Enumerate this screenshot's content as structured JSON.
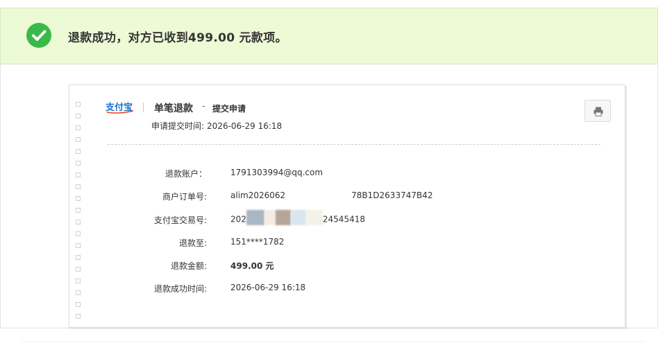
{
  "banner": {
    "message_prefix": "退款成功，对方已收到",
    "amount": "499.00",
    "message_suffix": " 元款项。"
  },
  "receipt": {
    "brand": "支付宝",
    "title": "单笔退款",
    "dash": "-",
    "subtitle": "提交申请",
    "submit_time_label": "申请提交时间:",
    "submit_time_value": "2026-06-29 16:18",
    "rows": [
      {
        "label": "退款账户：",
        "value": "1791303994@qq.com"
      },
      {
        "label": "商户订单号:",
        "value_start": "alim2026062",
        "value_end": "78B1D2633747B42"
      },
      {
        "label": "支付宝交易号:",
        "value_start": "202",
        "value_end": "24545418"
      },
      {
        "label": "退款至:",
        "value": "151****1782"
      },
      {
        "label": "退款金额:",
        "value": "499.00 元"
      },
      {
        "label": "退款成功时间:",
        "value": "2026-06-29 16:18"
      }
    ]
  },
  "colors": {
    "banner_bg": "#edfad6",
    "success_green": "#3bb84a",
    "brand_blue": "#1a6fd0",
    "brand_red": "#e8412c"
  },
  "icons": {
    "success": "check-circle-icon",
    "print": "printer-icon"
  }
}
